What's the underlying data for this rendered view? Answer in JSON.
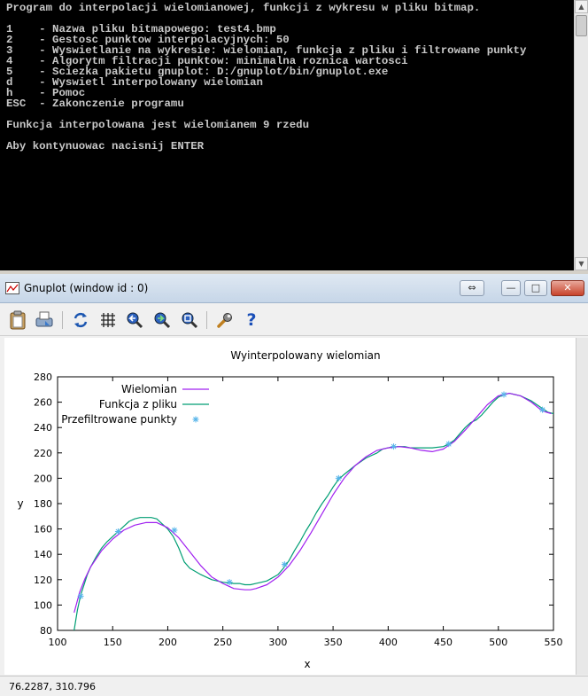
{
  "console": {
    "lines": [
      "Program do interpolacji wielomianowej, funkcji z wykresu w pliku bitmap.",
      "",
      "1    - Nazwa pliku bitmapowego: test4.bmp",
      "2    - Gestosc punktow interpolacyjnych: 50",
      "3    - Wyswietlanie na wykresie: wielomian, funkcja z pliku i filtrowane punkty",
      "4    - Algorytm filtracji punktow: minimalna roznica wartosci",
      "5    - Sciezka pakietu gnuplot: D:/gnuplot/bin/gnuplot.exe",
      "d    - Wyswietl interpolowany wielomian",
      "h    - Pomoc",
      "ESC  - Zakonczenie programu",
      "",
      "Funkcja interpolowana jest wielomianem 9 rzedu",
      "",
      "Aby kontynuowac nacisnij ENTER"
    ]
  },
  "window": {
    "title": "Gnuplot (window id : 0)",
    "controls": {
      "minimize": "—",
      "maximize": "□",
      "close": "✕"
    },
    "toolbar": [
      {
        "name": "copy-to-clipboard-icon"
      },
      {
        "name": "print-icon"
      },
      {
        "name": "replot-icon"
      },
      {
        "name": "grid-icon"
      },
      {
        "name": "zoom-previous-icon"
      },
      {
        "name": "zoom-next-icon"
      },
      {
        "name": "autoscale-icon"
      },
      {
        "name": "options-wrench-icon"
      },
      {
        "name": "help-icon",
        "label": "?"
      }
    ],
    "status": "76.2287, 310.796"
  },
  "chart_data": {
    "type": "line",
    "title": "Wyinterpolowany wielomian",
    "xlabel": "x",
    "ylabel": "y",
    "xlim": [
      100,
      550
    ],
    "ylim": [
      80,
      280
    ],
    "xticks": [
      100,
      150,
      200,
      250,
      300,
      350,
      400,
      450,
      500,
      550
    ],
    "yticks": [
      80,
      100,
      120,
      140,
      160,
      180,
      200,
      220,
      240,
      260,
      280
    ],
    "legend_position": "top-left",
    "series": [
      {
        "name": "Wielomian",
        "style": "line",
        "color": "#a020f0",
        "x": [
          115,
          120,
          125,
          130,
          140,
          150,
          160,
          170,
          180,
          190,
          200,
          210,
          220,
          230,
          240,
          250,
          260,
          270,
          275,
          280,
          290,
          300,
          310,
          320,
          330,
          340,
          350,
          360,
          370,
          380,
          390,
          400,
          410,
          420,
          430,
          440,
          450,
          460,
          470,
          480,
          490,
          500,
          510,
          520,
          530,
          540,
          548
        ],
        "y": [
          94,
          110,
          121,
          130,
          143,
          152,
          159,
          163,
          165,
          165,
          161,
          153,
          142,
          131,
          122,
          117,
          113,
          112,
          112,
          113,
          116,
          122,
          131,
          143,
          157,
          172,
          187,
          200,
          210,
          217,
          222,
          224,
          225,
          224,
          222,
          221,
          223,
          229,
          238,
          248,
          258,
          265,
          267,
          265,
          260,
          253,
          251
        ]
      },
      {
        "name": "Funkcja z pliku",
        "style": "line",
        "color": "#009e73",
        "x": [
          115,
          118,
          121,
          124,
          127,
          130,
          135,
          140,
          145,
          150,
          155,
          160,
          165,
          170,
          175,
          180,
          185,
          190,
          195,
          200,
          205,
          210,
          215,
          220,
          230,
          240,
          250,
          260,
          265,
          270,
          275,
          280,
          285,
          290,
          300,
          305,
          310,
          315,
          320,
          325,
          330,
          335,
          340,
          345,
          350,
          355,
          360,
          370,
          380,
          390,
          395,
          400,
          405,
          410,
          415,
          420,
          430,
          440,
          450,
          455,
          460,
          465,
          470,
          475,
          480,
          485,
          490,
          495,
          500,
          505,
          510,
          515,
          520,
          525,
          530,
          535,
          540,
          545,
          550
        ],
        "y": [
          80,
          96,
          108,
          116,
          124,
          130,
          138,
          145,
          150,
          154,
          158,
          162,
          166,
          168,
          169,
          169,
          169,
          168,
          164,
          160,
          154,
          145,
          134,
          129,
          124,
          120,
          118,
          117,
          117,
          116,
          116,
          117,
          118,
          119,
          124,
          129,
          135,
          143,
          150,
          158,
          165,
          173,
          180,
          186,
          193,
          199,
          203,
          210,
          216,
          220,
          223,
          224,
          225,
          225,
          225,
          224,
          224,
          224,
          225,
          227,
          230,
          235,
          240,
          244,
          246,
          250,
          255,
          260,
          264,
          266,
          267,
          266,
          265,
          263,
          261,
          258,
          255,
          252,
          251
        ]
      },
      {
        "name": "Przefiltrowane punkty",
        "style": "points",
        "color": "#56b4e9",
        "x": [
          121,
          155,
          206,
          256,
          306,
          355,
          405,
          455,
          505,
          540
        ],
        "y": [
          107,
          158,
          159,
          118,
          132,
          200,
          225,
          227,
          266,
          254
        ]
      }
    ]
  }
}
